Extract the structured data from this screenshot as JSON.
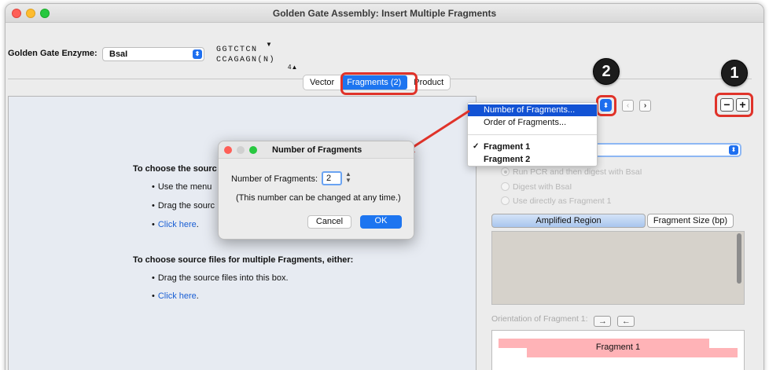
{
  "window": {
    "title": "Golden Gate Assembly: Insert Multiple Fragments"
  },
  "enzyme": {
    "label": "Golden Gate Enzyme:",
    "selected": "BsaI",
    "seq_top": "GGTCTCN",
    "seq_bottom": "CCAGAGN(N)",
    "seq_subscript": "4"
  },
  "tabs": [
    {
      "label": "Vector"
    },
    {
      "label": "Fragments (2)"
    },
    {
      "label": "Product"
    }
  ],
  "dropzone": {
    "single_heading": "To choose the sourc",
    "single_items": [
      "Use the menu",
      "Drag the sourc",
      "Click here"
    ],
    "multi_heading": "To choose source files for multiple Fragments, either:",
    "multi_items": [
      "Drag the source files into this box.",
      "Click here"
    ]
  },
  "menu": {
    "items": [
      "Number of Fragments...",
      "Order of Fragments..."
    ],
    "fragments": [
      "Fragment 1",
      "Fragment 2"
    ],
    "checkmark": "✓"
  },
  "dialog": {
    "title": "Number of Fragments",
    "field_label": "Number of Fragments:",
    "field_value": "2",
    "note": "(This number can be changed at any time.)",
    "cancel": "Cancel",
    "ok": "OK"
  },
  "right_panel": {
    "radios": [
      "Run PCR and then digest with BsaI",
      "Digest with BsaI",
      "Use directly as Fragment 1"
    ],
    "segment_a": "Amplified Region",
    "segment_b": "Fragment Size (bp)",
    "orientation_label": "Orientation of Fragment 1:",
    "fragment_label": "Fragment 1"
  },
  "badges": {
    "one": "1",
    "two": "2"
  },
  "colors": {
    "accent": "#1d75f0",
    "callout": "#e0332a",
    "fragment_bar": "#ffb3b7"
  }
}
